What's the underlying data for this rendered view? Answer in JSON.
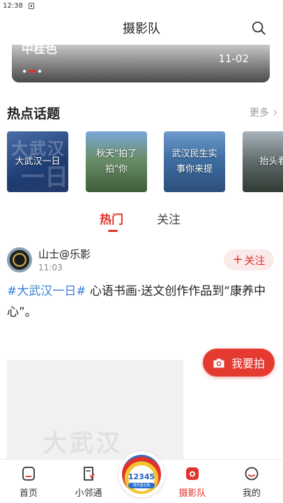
{
  "status_bar": {
    "time": "12:38"
  },
  "header": {
    "title": "摄影队"
  },
  "banner": {
    "text": "中桂色",
    "date": "11-02"
  },
  "hot_topics": {
    "title": "热点话题",
    "more": "更多",
    "items": [
      {
        "label": "大武汉一日"
      },
      {
        "label": "秋天\"拍了拍\"你"
      },
      {
        "label": "武汉民生实事你来提"
      },
      {
        "label": "抬头看"
      }
    ]
  },
  "feed_tabs": {
    "hot": "热门",
    "follow": "关注"
  },
  "post": {
    "username": "山士@乐影",
    "time": "11:03",
    "follow_label": "关注",
    "hashtag": "#大武汉一日#",
    "text": " 心语书画·送文创作作品到“康养中心”。",
    "image_watermark": "大武汉"
  },
  "fab": {
    "label": "我要拍"
  },
  "center_badge": {
    "number": "12345",
    "sub": "城市留言板"
  },
  "tabbar": {
    "home": "首页",
    "neighbor": "小邻通",
    "photo": "摄影队",
    "mine": "我的"
  },
  "colors": {
    "accent": "#e0332b",
    "hashtag": "#3a7fd5"
  }
}
